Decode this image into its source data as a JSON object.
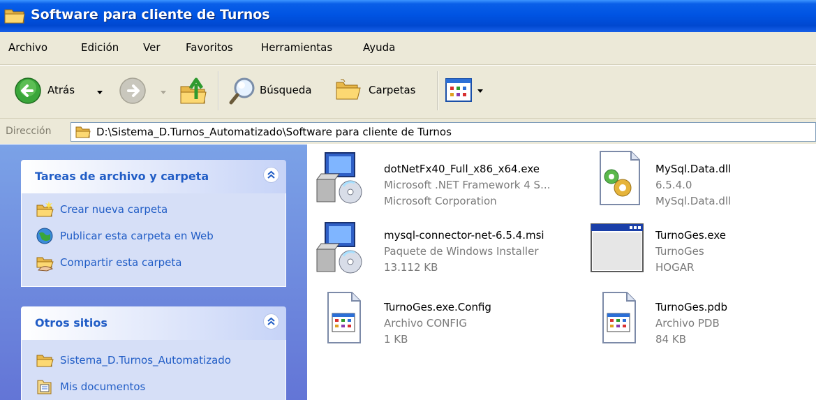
{
  "window": {
    "title": "Software para cliente de Turnos"
  },
  "menubar": {
    "items": [
      "Archivo",
      "Edición",
      "Ver",
      "Favoritos",
      "Herramientas",
      "Ayuda"
    ]
  },
  "toolbar": {
    "back_label": "Atrás",
    "search_label": "Búsqueda",
    "folders_label": "Carpetas"
  },
  "address": {
    "label": "Dirección",
    "value": "D:\\Sistema_D.Turnos_Automatizado\\Software para cliente de Turnos"
  },
  "taskpane": {
    "file_tasks": {
      "title": "Tareas de archivo y carpeta",
      "items": [
        {
          "label": "Crear nueva carpeta",
          "icon": "new-folder-icon"
        },
        {
          "label": "Publicar esta carpeta en Web",
          "icon": "publish-web-icon"
        },
        {
          "label": "Compartir esta carpeta",
          "icon": "share-folder-icon"
        }
      ]
    },
    "other_places": {
      "title": "Otros sitios",
      "items": [
        {
          "label": "Sistema_D.Turnos_Automatizado",
          "icon": "folder-icon"
        },
        {
          "label": "Mis documentos",
          "icon": "my-documents-icon"
        }
      ]
    }
  },
  "files": [
    {
      "name": "dotNetFx40_Full_x86_x64.exe",
      "line2": "Microsoft .NET Framework 4 S...",
      "line3": "Microsoft Corporation",
      "icon": "installer-icon"
    },
    {
      "name": "MySql.Data.dll",
      "line2": "6.5.4.0",
      "line3": "MySql.Data.dll",
      "icon": "dll-icon"
    },
    {
      "name": "mysql-connector-net-6.5.4.msi",
      "line2": "Paquete de Windows Installer",
      "line3": "13.112 KB",
      "icon": "msi-package-icon"
    },
    {
      "name": "TurnoGes.exe",
      "line2": "TurnoGes",
      "line3": "HOGAR",
      "icon": "application-window-icon"
    },
    {
      "name": "TurnoGes.exe.Config",
      "line2": "Archivo CONFIG",
      "line3": "1 KB",
      "icon": "config-file-icon"
    },
    {
      "name": "TurnoGes.pdb",
      "line2": "Archivo PDB",
      "line3": "84 KB",
      "icon": "pdb-file-icon"
    }
  ],
  "colors": {
    "titlebar": "#0054e3",
    "chrome": "#ece9d8",
    "taskpane": "#7ba2e7",
    "task_link": "#215dc6",
    "panel_body": "#d6dff7"
  }
}
